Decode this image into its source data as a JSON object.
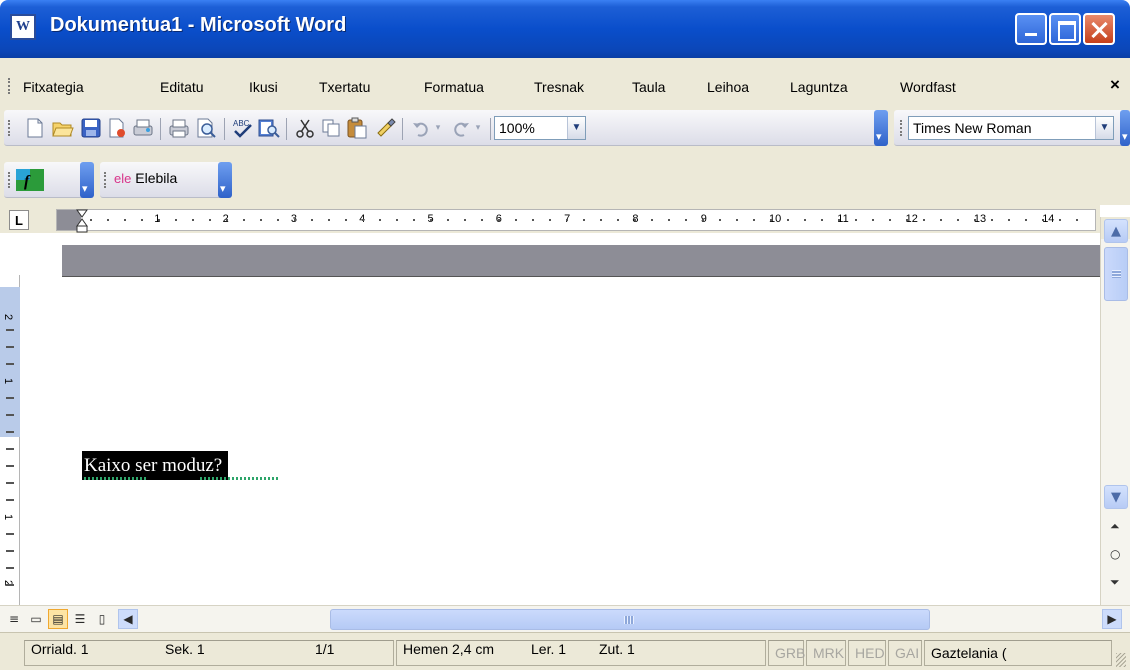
{
  "window": {
    "title": "Dokumentua1 - Microsoft Word",
    "app_icon_letter": "W"
  },
  "menu": {
    "items": [
      "Fitxategia",
      "Editatu",
      "Ikusi",
      "Txertatu",
      "Formatua",
      "Tresnak",
      "Taula",
      "Leihoa",
      "Laguntza",
      "Wordfast"
    ],
    "close_glyph": "×"
  },
  "toolbar": {
    "zoom": "100%",
    "font": "Times New Roman",
    "extra_label": "Elebila",
    "icons": [
      "new-icon",
      "open-icon",
      "save-icon",
      "permission-icon",
      "print-preview-icon",
      "print-icon",
      "search-icon",
      "spelling-icon",
      "research-icon",
      "cut-icon",
      "copy-icon",
      "paste-icon",
      "format-painter-icon",
      "undo-icon",
      "redo-icon"
    ]
  },
  "ruler": {
    "tab_selector": "L",
    "numbers": [
      "1",
      "2",
      "3",
      "4",
      "5",
      "6",
      "7",
      "8",
      "9",
      "10",
      "11",
      "12",
      "13",
      "14"
    ],
    "vertical_numbers": [
      "2",
      "1",
      "1",
      "2"
    ]
  },
  "document": {
    "text": "Kaixo ser moduz?"
  },
  "statusbar": {
    "page": "Orriald. 1",
    "section": "Sek. 1",
    "page_of": "1/1",
    "at": "Hemen 2,4 cm",
    "line": "Ler. 1",
    "column": "Zut. 1",
    "rec": "GRB",
    "trk": "MRK",
    "ext": "HED",
    "ovr": "GAI",
    "language": "Gaztelania ("
  },
  "colors": {
    "title_bar": "#0a4ecb",
    "selection_bg": "#000000",
    "chrome": "#ece9d8"
  }
}
